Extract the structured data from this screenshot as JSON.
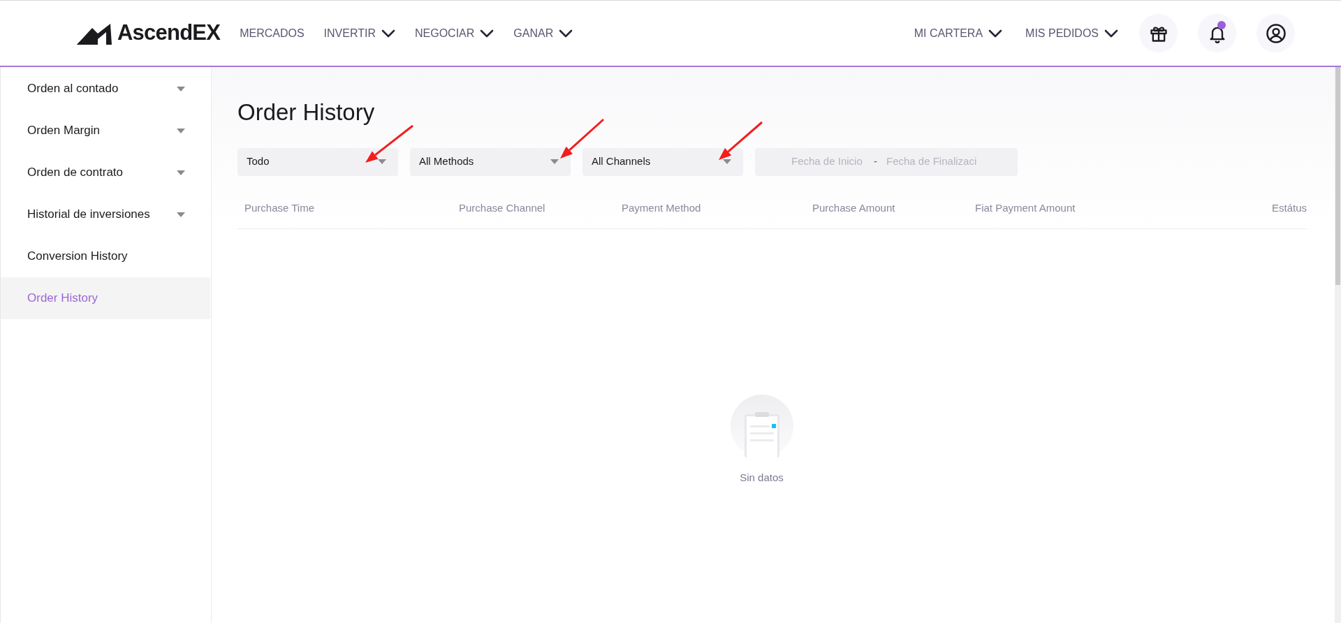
{
  "header": {
    "logo": "AscendEX",
    "nav": [
      {
        "label": "MERCADOS",
        "dropdown": false
      },
      {
        "label": "INVERTIR",
        "dropdown": true
      },
      {
        "label": "NEGOCIAR",
        "dropdown": true
      },
      {
        "label": "GANAR",
        "dropdown": true
      }
    ],
    "right_nav": [
      {
        "label": "MI CARTERA",
        "dropdown": true
      },
      {
        "label": "MIS PEDIDOS",
        "dropdown": true
      }
    ],
    "icons": [
      {
        "kind": "gift",
        "badge": false
      },
      {
        "kind": "bell",
        "badge": true
      },
      {
        "kind": "user",
        "badge": false
      }
    ]
  },
  "sidebar": {
    "items": [
      {
        "label": "Orden al contado",
        "expandable": true,
        "selected": false
      },
      {
        "label": "Orden Margin",
        "expandable": true,
        "selected": false
      },
      {
        "label": "Orden de contrato",
        "expandable": true,
        "selected": false
      },
      {
        "label": "Historial de inversiones",
        "expandable": true,
        "selected": false
      },
      {
        "label": "Conversion History",
        "expandable": false,
        "selected": false
      },
      {
        "label": "Order History",
        "expandable": false,
        "selected": true
      }
    ]
  },
  "page_title": "Order History",
  "filters": [
    {
      "value": "Todo"
    },
    {
      "value": "All Methods"
    },
    {
      "value": "All Channels"
    }
  ],
  "date_range": {
    "start_placeholder": "Fecha de Inicio",
    "separator": "-",
    "end_placeholder": "Fecha de Finalizaci"
  },
  "table": {
    "columns": [
      "Purchase Time",
      "Purchase Channel",
      "Payment Method",
      "Purchase Amount",
      "Fiat Payment Amount",
      "Estátus"
    ]
  },
  "empty_state": "Sin datos"
}
